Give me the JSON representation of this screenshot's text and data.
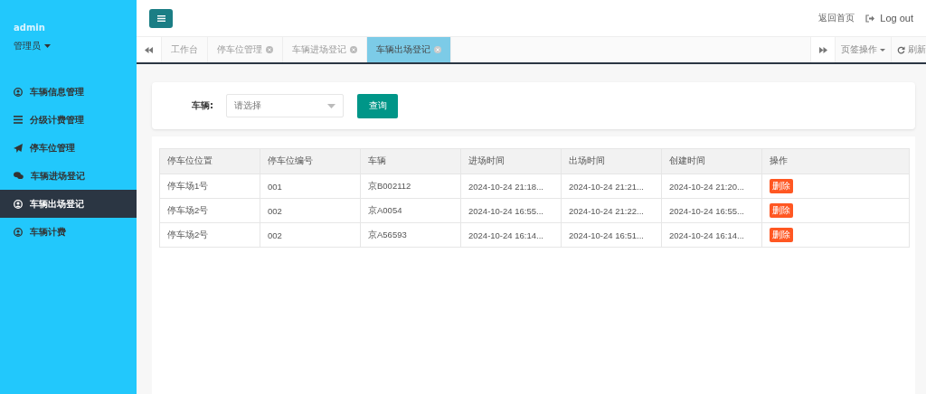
{
  "sidebar": {
    "username": "admin",
    "role": "管理员",
    "items": [
      {
        "label": "车辆信息管理",
        "selected": false
      },
      {
        "label": "分级计费管理",
        "selected": false
      },
      {
        "label": "停车位管理",
        "selected": false
      },
      {
        "label": "车辆进场登记",
        "selected": false
      },
      {
        "label": "车辆出场登记",
        "selected": true
      },
      {
        "label": "车辆计费",
        "selected": false
      }
    ]
  },
  "header": {
    "home_link": "返回首页",
    "logout": "Log out"
  },
  "tabs": [
    {
      "label": "工作台",
      "selected": false,
      "closable": false
    },
    {
      "label": "停车位管理",
      "selected": false,
      "closable": true
    },
    {
      "label": "车辆进场登记",
      "selected": false,
      "closable": true
    },
    {
      "label": "车辆出场登记",
      "selected": true,
      "closable": true
    }
  ],
  "tab_actions": {
    "menu": "页签操作",
    "refresh": "刷新"
  },
  "search": {
    "label": "车辆:",
    "placeholder": "请选择",
    "button": "查询"
  },
  "table": {
    "columns": [
      "停车位位置",
      "停车位编号",
      "车辆",
      "进场时间",
      "出场时间",
      "创建时间",
      "操作"
    ],
    "rows": [
      {
        "cells": [
          "停车场1号",
          "001",
          "京B002112",
          "2024-10-24 21:18...",
          "2024-10-24 21:21...",
          "2024-10-24 21:20..."
        ],
        "action": "删除"
      },
      {
        "cells": [
          "停车场2号",
          "002",
          "京A0054",
          "2024-10-24 16:55...",
          "2024-10-24 21:22...",
          "2024-10-24 16:55..."
        ],
        "action": "删除"
      },
      {
        "cells": [
          "停车场2号",
          "002",
          "京A56593",
          "2024-10-24 16:14...",
          "2024-10-24 16:51...",
          "2024-10-24 16:14..."
        ],
        "action": "删除"
      }
    ]
  }
}
